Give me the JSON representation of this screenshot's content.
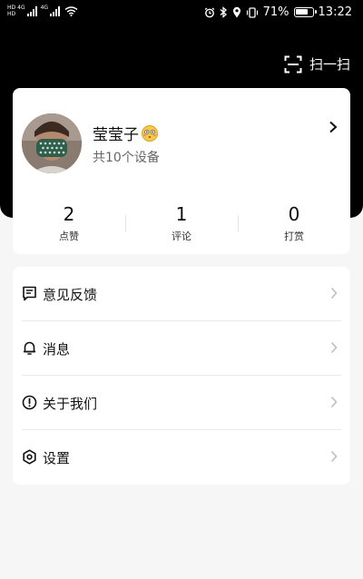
{
  "status_bar": {
    "left_tags": [
      "HD",
      "4G",
      "4G"
    ],
    "battery": "71%",
    "time": "13:22"
  },
  "header": {
    "scan_label": "扫一扫",
    "background": "#000000"
  },
  "profile": {
    "name": "莹莹子",
    "emoji": "flushed-face",
    "devices": "共10个设备",
    "stats": [
      {
        "value": "2",
        "label": "点赞"
      },
      {
        "value": "1",
        "label": "评论"
      },
      {
        "value": "0",
        "label": "打赏"
      }
    ]
  },
  "menu": {
    "items": [
      {
        "label": "意见反馈",
        "icon": "feedback-icon"
      },
      {
        "label": "消息",
        "icon": "bell-icon"
      },
      {
        "label": "关于我们",
        "icon": "info-icon"
      },
      {
        "label": "设置",
        "icon": "settings-icon"
      }
    ]
  },
  "colors": {
    "page_background": "#f6f6f6",
    "card_background": "#ffffff",
    "text_primary": "#111111",
    "chevron_gray": "#bbbbbb"
  }
}
